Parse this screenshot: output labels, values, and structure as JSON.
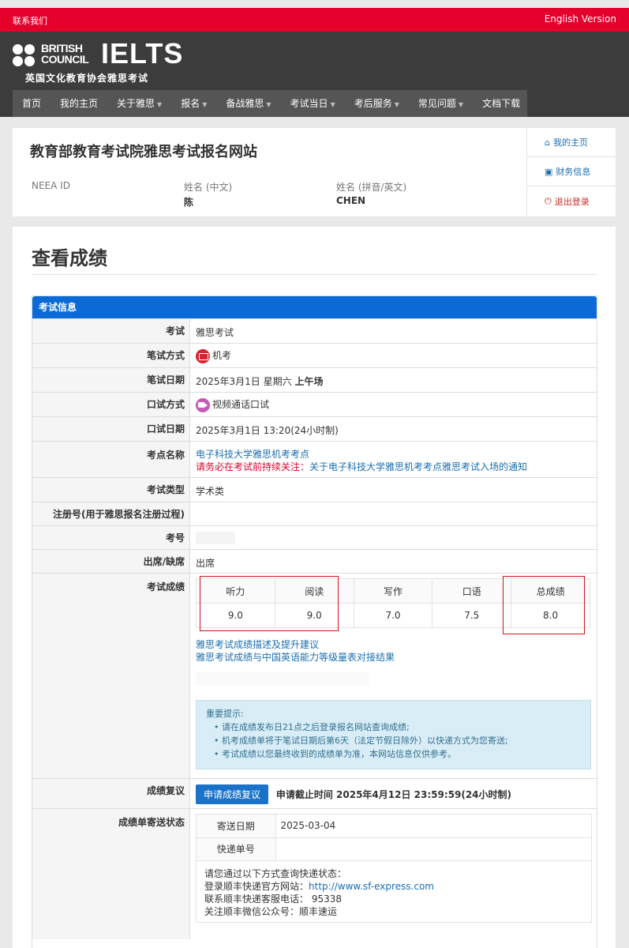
{
  "topbar": {
    "contact": "联系我们",
    "english": "English Version"
  },
  "brand": {
    "bc_line1": "BRITISH",
    "bc_line2": "COUNCIL",
    "ielts": "IELTS",
    "subtitle": "英国文化教育协会雅思考试"
  },
  "nav": [
    {
      "label": "首页",
      "caret": false
    },
    {
      "label": "我的主页",
      "caret": false
    },
    {
      "label": "关于雅思",
      "caret": true
    },
    {
      "label": "报名",
      "caret": true
    },
    {
      "label": "备战雅思",
      "caret": true
    },
    {
      "label": "考试当日",
      "caret": true
    },
    {
      "label": "考后服务",
      "caret": true
    },
    {
      "label": "常见问题",
      "caret": true
    },
    {
      "label": "文档下载",
      "caret": false
    }
  ],
  "profile": {
    "site_title": "教育部教育考试院雅思考试报名网站",
    "neea_label": "NEEA ID",
    "name_cn_label": "姓名 (中文)",
    "name_cn_value": "陈",
    "name_en_label": "姓名 (拼音/英文)",
    "name_en_value": "CHEN"
  },
  "side_menu": {
    "home": "我的主页",
    "finance": "财务信息",
    "logout": "退出登录"
  },
  "page_title": "查看成绩",
  "panel_title": "考试信息",
  "rows": {
    "exam_label": "考试",
    "exam_value": "雅思考试",
    "written_mode_label": "笔试方式",
    "written_mode_value": "机考",
    "written_date_label": "笔试日期",
    "written_date_value": "2025年3月1日 星期六",
    "written_session": "上午场",
    "oral_mode_label": "口试方式",
    "oral_mode_value": "视频通话口试",
    "oral_date_label": "口试日期",
    "oral_date_value": "2025年3月1日 13:20(24小时制)",
    "venue_label": "考点名称",
    "venue_value": "电子科技大学雅思机考考点",
    "venue_notice_prefix": "请务必在考试前持续关注：",
    "venue_notice_link": "关于电子科技大学雅思机考考点雅思考试入场的通知",
    "type_label": "考试类型",
    "type_value": "学术类",
    "reg_label": "注册号(用于雅思报名注册过程)",
    "candidate_label": "考号",
    "attendance_label": "出席/缺席",
    "attendance_value": "出席",
    "scores_label": "考试成绩",
    "recheck_label": "成绩复议",
    "recheck_button": "申请成绩复议",
    "recheck_deadline": "申请截止时间 2025年4月12日 23:59:59(24小时制)",
    "mail_label": "成绩单寄送状态"
  },
  "scores": {
    "headers": [
      "听力",
      "阅读",
      "写作",
      "口语",
      "总成绩"
    ],
    "values": [
      "9.0",
      "9.0",
      "7.0",
      "7.5",
      "8.0"
    ]
  },
  "score_links": [
    "雅思考试成绩描述及提升建议",
    "雅思考试成绩与中国英语能力等级量表对接结果"
  ],
  "tip": {
    "title": "重要提示:",
    "items": [
      "请在成绩发布日21点之后登录报名网站查询成绩;",
      "机考成绩单将于笔试日期后第6天（法定节假日除外）以快递方式为您寄送;",
      "考试成绩以您最终收到的成绩单为准，本网站信息仅供参考。"
    ]
  },
  "mail": {
    "date_label": "寄送日期",
    "date_value": "2025-03-04",
    "tracking_label": "快递单号",
    "info_line1": "请您通过以下方式查询快递状态：",
    "info_line2_prefix": "登录顺丰快递官方网站：",
    "info_line2_link": "http://www.sf-express.com",
    "info_line3": "联系顺丰快递客服电话：  95338",
    "info_line4": "关注顺丰微信公众号：顺丰速运"
  },
  "colors": {
    "topbar": "#e4002b",
    "header": "#3c3c3c",
    "nav": "#555555",
    "panel_head": "#0b6bd6",
    "link": "#1a6fb0",
    "highlight_box": "#d0121b"
  }
}
